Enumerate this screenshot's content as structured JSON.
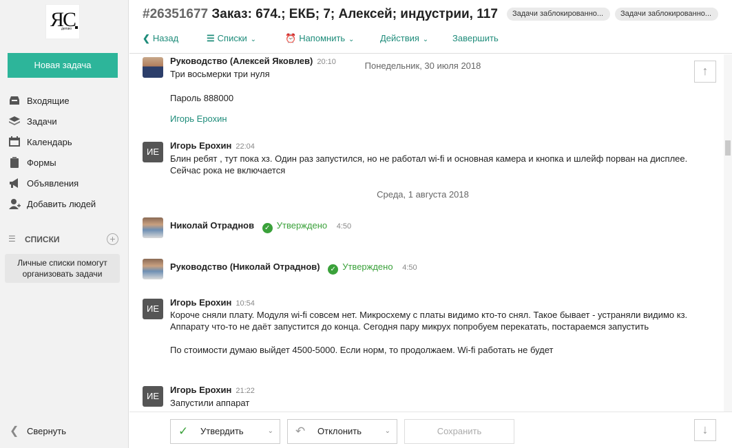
{
  "sidebar": {
    "logo_text": "ЯС",
    "logo_sub": "делаю",
    "new_task": "Новая задача",
    "items": [
      {
        "label": "Входящие",
        "icon": "inbox-icon"
      },
      {
        "label": "Задачи",
        "icon": "layers-icon"
      },
      {
        "label": "Календарь",
        "icon": "calendar-icon"
      },
      {
        "label": "Формы",
        "icon": "clipboard-icon"
      },
      {
        "label": "Объявления",
        "icon": "megaphone-icon"
      },
      {
        "label": "Добавить людей",
        "icon": "add-user-icon"
      }
    ],
    "lists_label": "СПИСКИ",
    "lists_hint": "Личные списки помогут организовать задачи",
    "collapse": "Свернуть"
  },
  "header": {
    "task_number": "#26351677",
    "title": "Заказ: 674.; ЕКБ; 7; Алексей; индустрии, 117",
    "tags": [
      "Задачи заблокированно...",
      "Задачи заблокированно..."
    ],
    "toolbar": {
      "back": "Назад",
      "lists": "Списки",
      "remind": "Напомнить",
      "actions": "Действия",
      "finish": "Завершить"
    }
  },
  "feed": {
    "messages": [
      {
        "author": "Руководство (Алексей Яковлев)",
        "time": "20:10",
        "lines": [
          "Три восьмерки три нуля",
          "Пароль 888000"
        ],
        "link": "Игорь Ерохин"
      },
      {
        "author": "Игорь Ерохин",
        "initials": "ИЕ",
        "time": "22:04",
        "text": "Блин ребят , тут пока хз. Один раз запустился, но не работал wi-fi и основная камера и кнопка и шлейф порван на дисплее. Сейчас рока не включается"
      },
      {
        "author": "Николай Отраднов",
        "status": "Утверждено",
        "time": "4:50"
      },
      {
        "author": "Руководство (Николай Отраднов)",
        "status": "Утверждено",
        "time": "4:50"
      },
      {
        "author": "Игорь Ерохин",
        "initials": "ИЕ",
        "time": "10:54",
        "text": "Короче сняли плату. Модуля wi-fi совсем нет. Микросхему с платы видимо кто-то снял. Такое бывает - устраняли видимо кз. Аппарату что-то не даёт запустится до конца. Сегодня пару микрух попробуем перекатать, постараемся запустить",
        "text2": "По стоимости думаю выйдет 4500-5000. Если норм, то продолжаем. Wi-fi работать не будет"
      },
      {
        "author": "Игорь Ерохин",
        "initials": "ИЕ",
        "time": "21:22",
        "text": "Запустили аппарат"
      }
    ],
    "dates": [
      "Понедельник, 30 июля 2018",
      "Среда, 1 августа 2018"
    ]
  },
  "footer": {
    "approve": "Утвердить",
    "reject": "Отклонить",
    "save": "Сохранить"
  },
  "colors": {
    "accent": "#2db59a",
    "link": "#1e8c7a",
    "approved": "#3aa13a"
  }
}
